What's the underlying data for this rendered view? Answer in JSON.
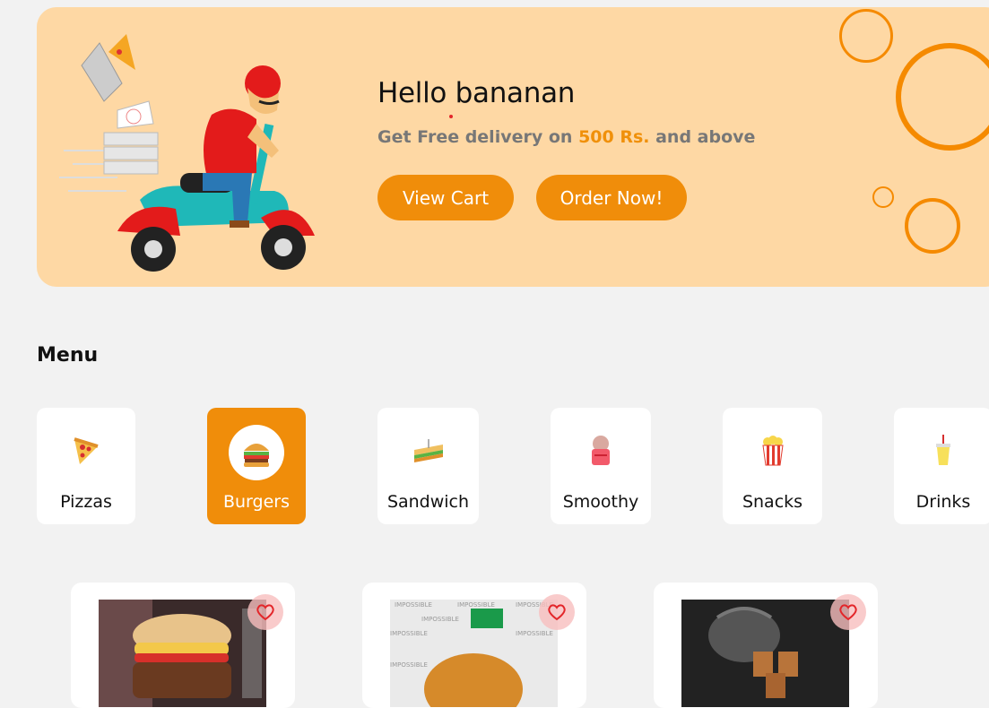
{
  "banner": {
    "greeting": "Hello bananan",
    "tagline_prefix": "Get Free delivery on ",
    "tagline_amount": "500 Rs.",
    "tagline_suffix": " and above",
    "view_cart_label": "View Cart",
    "order_now_label": "Order Now!"
  },
  "menu": {
    "title": "Menu",
    "categories": [
      {
        "label": "Pizzas",
        "icon": "pizza-icon"
      },
      {
        "label": "Burgers",
        "icon": "burger-icon",
        "active": true
      },
      {
        "label": "Sandwich",
        "icon": "sandwich-icon"
      },
      {
        "label": "Smoothy",
        "icon": "smoothie-icon"
      },
      {
        "label": "Snacks",
        "icon": "popcorn-icon"
      },
      {
        "label": "Drinks",
        "icon": "drink-icon"
      }
    ]
  },
  "products": [
    {
      "image": "burger-photo"
    },
    {
      "image": "impossible-burger-photo"
    },
    {
      "image": "tea-kettle-photo"
    }
  ],
  "colors": {
    "accent": "#f08d0a",
    "banner_bg": "#fed8a4",
    "page_bg": "#f2f2f2"
  }
}
